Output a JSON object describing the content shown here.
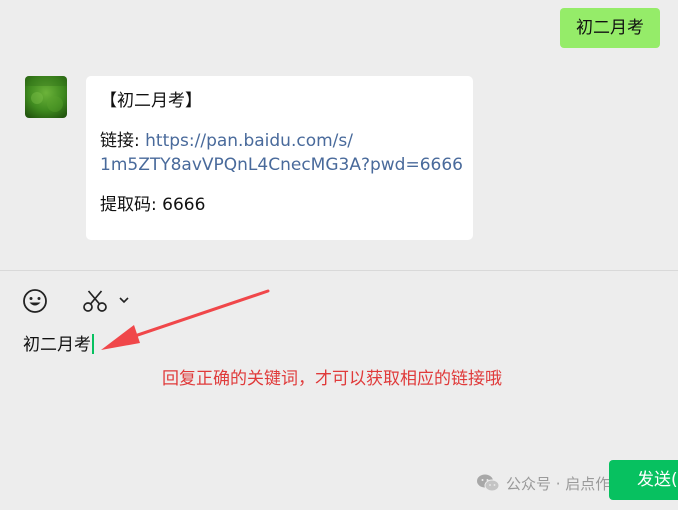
{
  "chat": {
    "sent_message": "初二月考",
    "received": {
      "title": "【初二月考】",
      "link_label": "链接: ",
      "link_part1": "https://pan.baidu.com/s/",
      "link_part2": "1m5ZTY8avVPQnL4CnecMG3A?pwd=6666",
      "code_line": "提取码: 6666"
    }
  },
  "input": {
    "typed_text": "初二月考"
  },
  "annotation": {
    "text": "回复正确的关键词，才可以获取相应的链接哦"
  },
  "watermark": {
    "text": "公众号 · 启点作为"
  },
  "send_button": {
    "label": "发送(S)"
  },
  "colors": {
    "sent_bubble": "#95ec69",
    "send_button": "#07c160",
    "annotation": "#e03a3a",
    "link": "#496a9b"
  },
  "icons": [
    "emoji-icon",
    "scissors-icon",
    "chevron-down-icon",
    "wechat-icon"
  ]
}
